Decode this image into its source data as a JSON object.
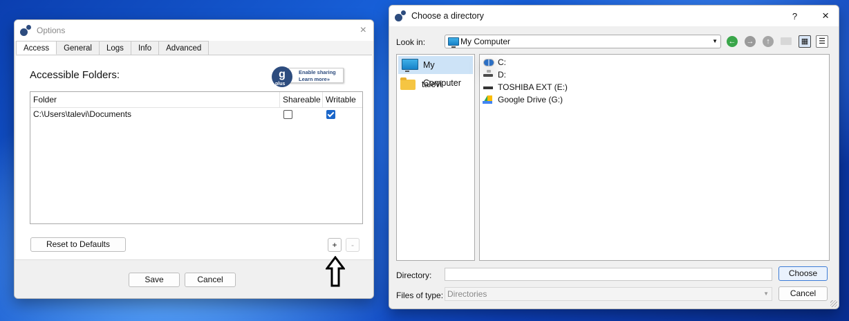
{
  "options": {
    "title": "Options",
    "close_icon": "×",
    "tabs": [
      "Access",
      "General",
      "Logs",
      "Info",
      "Advanced"
    ],
    "section_title": "Accessible Folders:",
    "badge": {
      "letter": "g",
      "plus": "plus",
      "line1": "Enable sharing",
      "line2": "Learn more»"
    },
    "table": {
      "headers": [
        "Folder",
        "Shareable",
        "Writable"
      ],
      "rows": [
        {
          "folder": "C:\\Users\\talevi\\Documents",
          "shareable": false,
          "writable": true
        }
      ]
    },
    "reset_label": "Reset to Defaults",
    "add_label": "+",
    "remove_label": "-",
    "save_label": "Save",
    "cancel_label": "Cancel"
  },
  "chooser": {
    "title": "Choose a directory",
    "help_label": "?",
    "close_icon": "×",
    "lookin_label": "Look in:",
    "lookin_value": "My Computer",
    "caret": "▼",
    "sidebar": [
      "My Computer",
      "talevi"
    ],
    "drives": [
      "C:",
      "D:",
      "TOSHIBA EXT (E:)",
      "Google Drive (G:)"
    ],
    "directory_label": "Directory:",
    "directory_value": "",
    "choose_label": "Choose",
    "filetype_label": "Files of type:",
    "filetype_value": "Directories",
    "cancel_label": "Cancel",
    "nav": {
      "back": "←",
      "forward": "→",
      "up": "↑"
    },
    "colors": {
      "back": "#3aa64a",
      "forward": "#9a9a9a",
      "up": "#a6a6a6"
    }
  },
  "colors": {
    "accent": "#1a66c9",
    "selection": "#cde3f7"
  }
}
